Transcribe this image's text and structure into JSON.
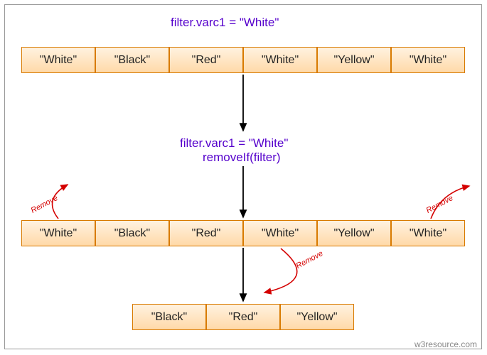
{
  "captions": {
    "top": "filter.varc1 = \"White\"",
    "mid_line1": "filter.varc1 = \"White\"",
    "mid_line2": "removeIf(filter)"
  },
  "rows": {
    "row1": [
      "\"White\"",
      "\"Black\"",
      "\"Red\"",
      "\"White\"",
      "\"Yellow\"",
      "\"White\""
    ],
    "row2": [
      "\"White\"",
      "\"Black\"",
      "\"Red\"",
      "\"White\"",
      "\"Yellow\"",
      "\"White\""
    ],
    "row3": [
      "\"Black\"",
      "\"Red\"",
      "\"Yellow\""
    ]
  },
  "remove_labels": {
    "r1": "Remove",
    "r2": "Remove",
    "r3": "Remove"
  },
  "watermark": "w3resource.com",
  "chart_data": {
    "type": "table",
    "title": "removeIf(filter) diagram",
    "filter_value": "White",
    "before": [
      "White",
      "Black",
      "Red",
      "White",
      "Yellow",
      "White"
    ],
    "after": [
      "Black",
      "Red",
      "Yellow"
    ],
    "removed_indices": [
      0,
      3,
      5
    ]
  }
}
